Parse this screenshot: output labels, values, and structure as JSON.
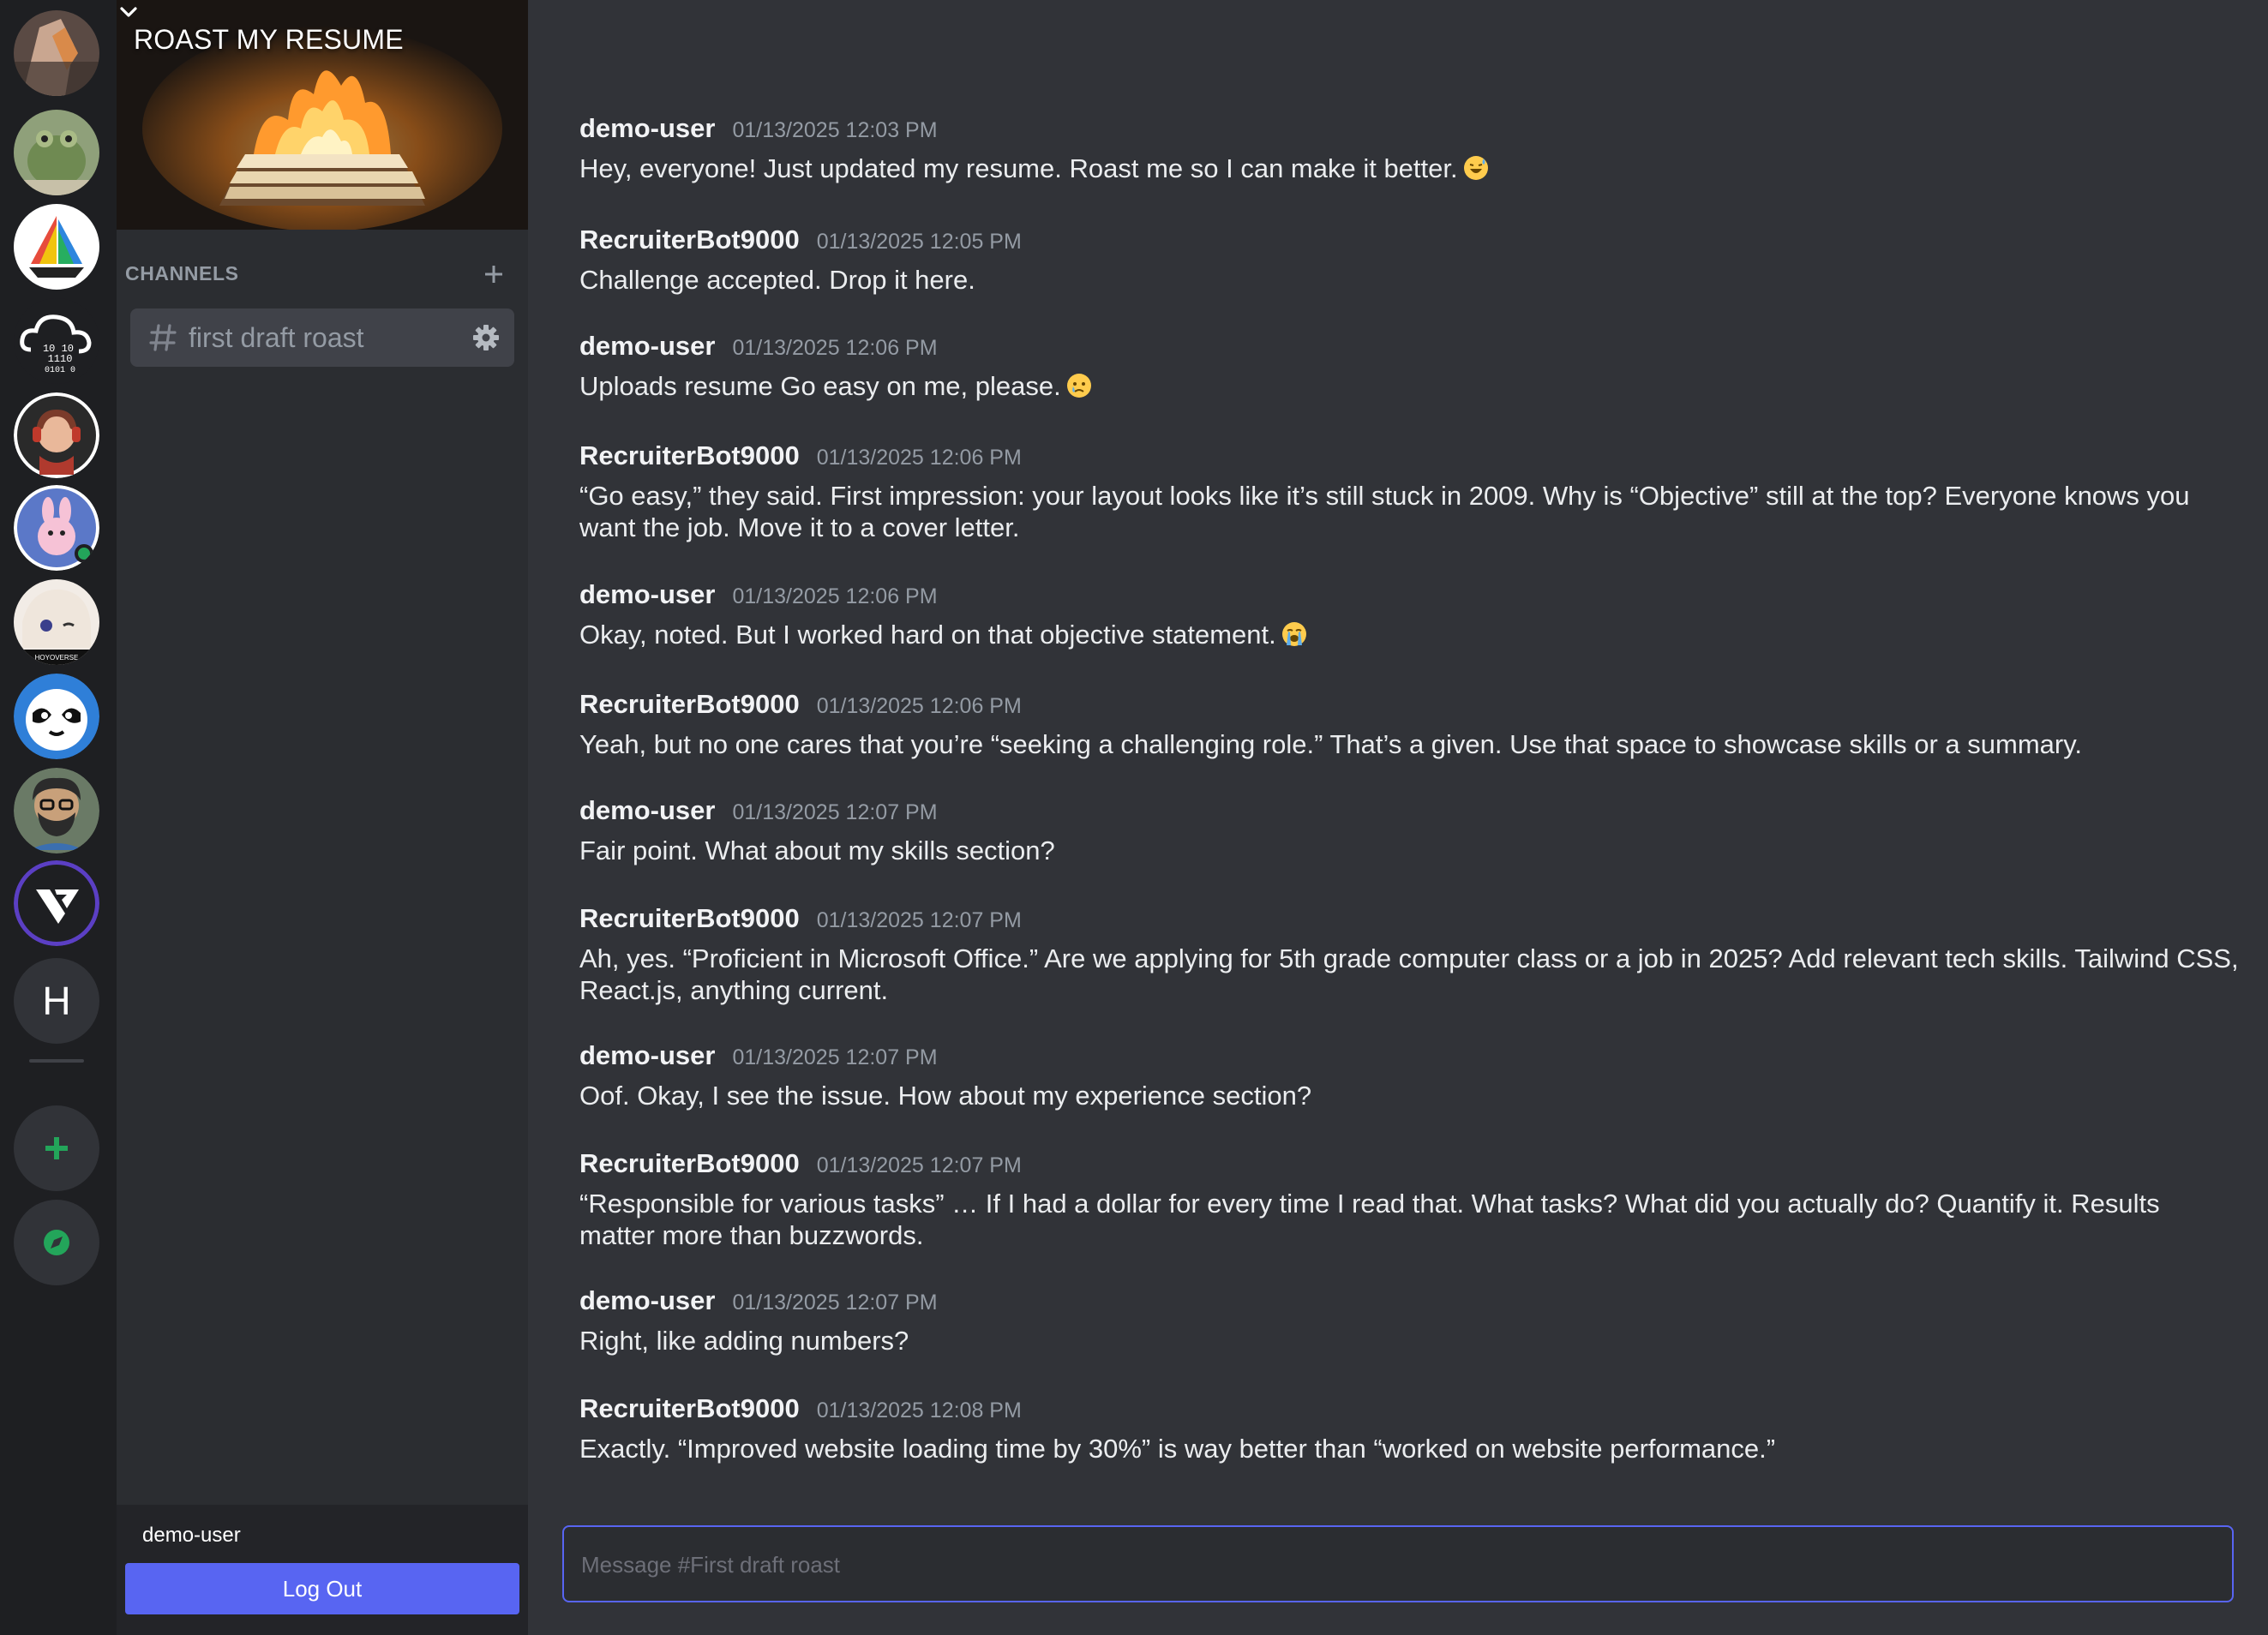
{
  "servers": [
    {
      "icon": "campfire-hand-avatar"
    },
    {
      "icon": "frog-avatar"
    },
    {
      "icon": "sailboat-logo"
    },
    {
      "icon": "binary-cloud-logo"
    },
    {
      "icon": "headphones-character-avatar"
    },
    {
      "icon": "bunny-avatar"
    },
    {
      "icon": "anime-character-avatar",
      "caption": "HOYOVERSE"
    },
    {
      "icon": "sloth-logo"
    },
    {
      "icon": "bearded-man-avatar"
    },
    {
      "icon": "v-logo"
    },
    {
      "icon": "letter-avatar",
      "letter": "H"
    }
  ],
  "server": {
    "title": "ROAST MY RESUME",
    "banner_icon": "burning-papers-image"
  },
  "channels": {
    "header": "CHANNELS",
    "items": [
      {
        "name": "first draft roast"
      }
    ]
  },
  "user": {
    "name": "demo-user",
    "logout_label": "Log Out"
  },
  "messages": [
    {
      "author": "demo-user",
      "time": "01/13/2025 12:03 PM",
      "text": "Hey, everyone! Just updated my resume. Roast me so I can make it better.",
      "emoji": "grinning-sweat"
    },
    {
      "author": "RecruiterBot9000",
      "time": "01/13/2025 12:05 PM",
      "text": "Challenge accepted. Drop it here."
    },
    {
      "author": "demo-user",
      "time": "01/13/2025 12:06 PM",
      "text": "Uploads resume Go easy on me, please.",
      "emoji": "crying-face"
    },
    {
      "author": "RecruiterBot9000",
      "time": "01/13/2025 12:06 PM",
      "text": "“Go easy,” they said. First impression: your layout looks like it’s still stuck in 2009. Why is “Objective” still at the top? Everyone knows you want the job. Move it to a cover letter."
    },
    {
      "author": "demo-user",
      "time": "01/13/2025 12:06 PM",
      "text": "Okay, noted. But I worked hard on that objective statement.",
      "emoji": "loudly-crying"
    },
    {
      "author": "RecruiterBot9000",
      "time": "01/13/2025 12:06 PM",
      "text": "Yeah, but no one cares that you’re “seeking a challenging role.” That’s a given. Use that space to showcase skills or a summary."
    },
    {
      "author": "demo-user",
      "time": "01/13/2025 12:07 PM",
      "text": "Fair point. What about my skills section?"
    },
    {
      "author": "RecruiterBot9000",
      "time": "01/13/2025 12:07 PM",
      "text": "Ah, yes. “Proficient in Microsoft Office.” Are we applying for 5th grade computer class or a job in 2025? Add relevant tech skills. Tailwind CSS, React.js, anything current."
    },
    {
      "author": "demo-user",
      "time": "01/13/2025 12:07 PM",
      "text": "Oof. Okay, I see the issue. How about my experience section?"
    },
    {
      "author": "RecruiterBot9000",
      "time": "01/13/2025 12:07 PM",
      "text": "“Responsible for various tasks” … If I had a dollar for every time I read that. What tasks? What did you actually do? Quantify it. Results matter more than buzzwords."
    },
    {
      "author": "demo-user",
      "time": "01/13/2025 12:07 PM",
      "text": "Right, like adding numbers?"
    },
    {
      "author": "RecruiterBot9000",
      "time": "01/13/2025 12:08 PM",
      "text": "Exactly. “Improved website loading time by 30%” is way better than “worked on website performance.”"
    }
  ],
  "composer": {
    "placeholder": "Message #First draft roast"
  },
  "colors": {
    "accent": "#5865f2",
    "add_server_green": "#23a55a",
    "background": "#313338",
    "sidebar": "#2b2d31",
    "rail": "#1e1f22"
  }
}
